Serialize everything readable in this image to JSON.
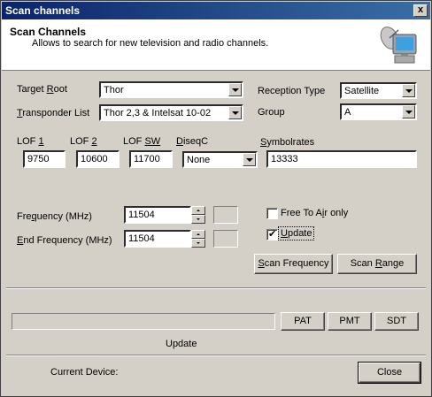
{
  "window": {
    "title": "Scan channels",
    "close_glyph": "x"
  },
  "header": {
    "title": "Scan Channels",
    "subtitle": "Allows to search for new television and radio channels.",
    "icon": "monitor-satellite-icon"
  },
  "fields": {
    "target_root": {
      "label": "Target Root",
      "value": "Thor"
    },
    "transponder_list": {
      "label": "Transponder List",
      "value": "Thor 2,3 & Intelsat 10-02"
    },
    "reception_type": {
      "label": "Reception Type",
      "value": "Satellite"
    },
    "group": {
      "label": "Group",
      "value": "A"
    },
    "lof1": {
      "label": "LOF 1",
      "value": "9750"
    },
    "lof2": {
      "label": "LOF 2",
      "value": "10600"
    },
    "lof_sw": {
      "label": "LOF SW",
      "value": "11700"
    },
    "diseqc": {
      "label": "DiseqC",
      "value": "None"
    },
    "symbolrates": {
      "label": "Symbolrates",
      "value": "13333"
    },
    "frequency": {
      "label": "Frequency (MHz)",
      "value": "11504"
    },
    "end_frequency": {
      "label": "End  Frequency (MHz)",
      "value": "11504"
    }
  },
  "options": {
    "free_to_air": {
      "label": "Free To Air only",
      "checked": false
    },
    "update": {
      "label": "Update",
      "checked": true
    }
  },
  "buttons": {
    "scan_frequency": "Scan Frequency",
    "scan_range": "Scan Range",
    "pat": "PAT",
    "pmt": "PMT",
    "sdt": "SDT",
    "close": "Close"
  },
  "status": {
    "progress": 0,
    "text": "Update",
    "current_device_label": "Current Device:"
  }
}
